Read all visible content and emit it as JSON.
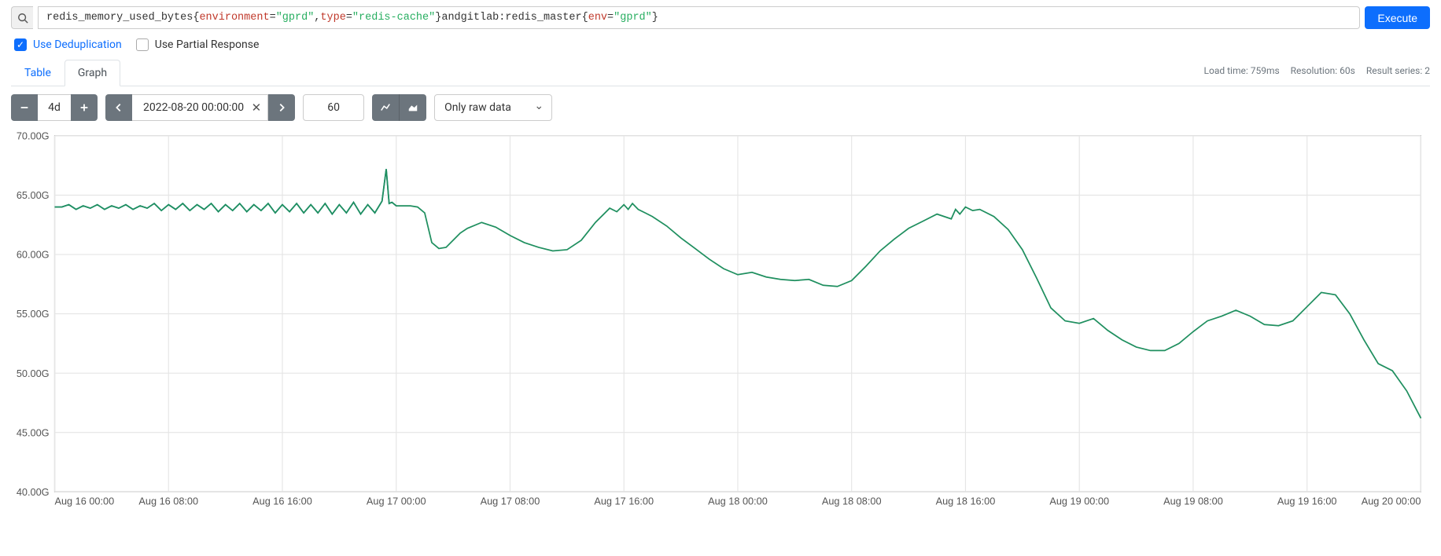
{
  "query": {
    "raw": "redis_memory_used_bytes{environment=\"gprd\", type=\"redis-cache\"} and gitlab:redis_master{env=\"gprd\"}",
    "tokens": [
      {
        "t": "metric",
        "v": "redis_memory_used_bytes"
      },
      {
        "t": "op",
        "v": "{"
      },
      {
        "t": "label",
        "v": "environment"
      },
      {
        "t": "op",
        "v": "="
      },
      {
        "t": "val",
        "v": "\"gprd\""
      },
      {
        "t": "op",
        "v": ", "
      },
      {
        "t": "label",
        "v": "type"
      },
      {
        "t": "op",
        "v": "="
      },
      {
        "t": "val",
        "v": "\"redis-cache\""
      },
      {
        "t": "op",
        "v": "} "
      },
      {
        "t": "metric",
        "v": "and"
      },
      {
        "t": "metric",
        "v": " gitlab:redis_master"
      },
      {
        "t": "op",
        "v": "{"
      },
      {
        "t": "label",
        "v": "env"
      },
      {
        "t": "op",
        "v": "="
      },
      {
        "t": "val",
        "v": "\"gprd\""
      },
      {
        "t": "op",
        "v": "}"
      }
    ]
  },
  "execute_label": "Execute",
  "options": {
    "dedup_label": "Use Deduplication",
    "dedup_checked": true,
    "partial_label": "Use Partial Response",
    "partial_checked": false
  },
  "tabs": {
    "table": "Table",
    "graph": "Graph",
    "active": "graph"
  },
  "status": {
    "load_time": "Load time: 759ms",
    "resolution": "Resolution: 60s",
    "series_count": "Result series: 2"
  },
  "controls": {
    "range": "4d",
    "end_time": "2022-08-20 00:00:00",
    "step": "60",
    "raw_label": "Only raw data"
  },
  "chart_data": {
    "type": "line",
    "xlabel": "",
    "ylabel": "",
    "ylim": [
      40,
      70
    ],
    "y_ticks": [
      "40.00G",
      "45.00G",
      "50.00G",
      "55.00G",
      "60.00G",
      "65.00G",
      "70.00G"
    ],
    "x_ticks": [
      "Aug 16 00:00",
      "Aug 16 08:00",
      "Aug 16 16:00",
      "Aug 17 00:00",
      "Aug 17 08:00",
      "Aug 17 16:00",
      "Aug 18 00:00",
      "Aug 18 08:00",
      "Aug 18 16:00",
      "Aug 19 00:00",
      "Aug 19 08:00",
      "Aug 19 16:00",
      "Aug 20 00:00"
    ],
    "xlim_hours": [
      0,
      96
    ],
    "series": [
      {
        "name": "series-1-teal",
        "color": "#2d8fa8",
        "x_hours": [
          0,
          0.5,
          1,
          1.5,
          2,
          2.5,
          3,
          3.5,
          4,
          4.5,
          5,
          5.5,
          6,
          6.5,
          7,
          7.5,
          8,
          8.5,
          9,
          9.5,
          10,
          10.5,
          11,
          11.5,
          12,
          12.5,
          13,
          13.5,
          14,
          14.5,
          15,
          15.5,
          16,
          16.5,
          17,
          17.5,
          18,
          18.5,
          19,
          19.5,
          20,
          20.5,
          21,
          21.5,
          22,
          22.5,
          23,
          23.3,
          23.5,
          23.7,
          24
        ],
        "values_g": [
          64.0,
          64.0,
          64.2,
          63.8,
          64.1,
          63.9,
          64.2,
          63.8,
          64.1,
          63.9,
          64.2,
          63.8,
          64.1,
          63.9,
          64.3,
          63.7,
          64.2,
          63.8,
          64.3,
          63.7,
          64.2,
          63.8,
          64.3,
          63.6,
          64.2,
          63.7,
          64.3,
          63.6,
          64.2,
          63.7,
          64.3,
          63.5,
          64.2,
          63.6,
          64.3,
          63.5,
          64.2,
          63.5,
          64.3,
          63.4,
          64.2,
          63.5,
          64.4,
          63.4,
          64.2,
          63.5,
          64.5,
          67.2,
          64.3,
          64.4,
          64.1
        ]
      },
      {
        "name": "series-2-green",
        "color": "#1f8f5f",
        "x_hours": [
          0,
          0.5,
          1,
          1.5,
          2,
          2.5,
          3,
          3.5,
          4,
          4.5,
          5,
          5.5,
          6,
          6.5,
          7,
          7.5,
          8,
          8.5,
          9,
          9.5,
          10,
          10.5,
          11,
          11.5,
          12,
          12.5,
          13,
          13.5,
          14,
          14.5,
          15,
          15.5,
          16,
          16.5,
          17,
          17.5,
          18,
          18.5,
          19,
          19.5,
          20,
          20.5,
          21,
          21.5,
          22,
          22.5,
          23,
          23.3,
          23.5,
          23.7,
          24,
          24.5,
          25,
          25.5,
          26,
          26.5,
          27,
          27.5,
          28,
          28.5,
          29,
          30,
          31,
          32,
          33,
          34,
          35,
          36,
          37,
          38,
          39,
          39.5,
          40,
          40.3,
          40.6,
          41,
          41.5,
          42,
          43,
          44,
          45,
          46,
          47,
          48,
          49,
          50,
          51,
          52,
          53,
          54,
          55,
          56,
          57,
          58,
          59,
          60,
          61,
          62,
          63,
          63.3,
          63.6,
          64,
          64.5,
          65,
          66,
          67,
          68,
          69,
          70,
          71,
          72,
          73,
          74,
          75,
          76,
          77,
          78,
          79,
          80,
          81,
          82,
          83,
          84,
          85,
          86,
          87,
          88,
          89,
          90,
          91,
          92,
          93,
          94,
          95,
          96
        ],
        "values_g": [
          64.0,
          64.0,
          64.2,
          63.8,
          64.1,
          63.9,
          64.2,
          63.8,
          64.1,
          63.9,
          64.2,
          63.8,
          64.1,
          63.9,
          64.3,
          63.7,
          64.2,
          63.8,
          64.3,
          63.7,
          64.2,
          63.8,
          64.3,
          63.6,
          64.2,
          63.7,
          64.3,
          63.6,
          64.2,
          63.7,
          64.3,
          63.5,
          64.2,
          63.6,
          64.3,
          63.5,
          64.2,
          63.5,
          64.3,
          63.4,
          64.2,
          63.5,
          64.4,
          63.4,
          64.2,
          63.5,
          64.5,
          67.2,
          64.3,
          64.4,
          64.1,
          64.1,
          64.1,
          64.0,
          63.5,
          61.0,
          60.5,
          60.6,
          61.2,
          61.8,
          62.2,
          62.7,
          62.3,
          61.6,
          61.0,
          60.6,
          60.3,
          60.4,
          61.2,
          62.7,
          63.9,
          63.6,
          64.2,
          63.8,
          64.3,
          63.8,
          63.5,
          63.2,
          62.4,
          61.4,
          60.5,
          59.6,
          58.8,
          58.3,
          58.5,
          58.1,
          57.9,
          57.8,
          57.9,
          57.4,
          57.3,
          57.8,
          59.0,
          60.3,
          61.3,
          62.2,
          62.8,
          63.4,
          63.0,
          63.8,
          63.4,
          64.0,
          63.7,
          63.8,
          63.2,
          62.1,
          60.4,
          58.0,
          55.5,
          54.4,
          54.2,
          54.6,
          53.6,
          52.8,
          52.2,
          51.9,
          51.9,
          52.5,
          53.5,
          54.4,
          54.8,
          55.3,
          54.8,
          54.1,
          54.0,
          54.4,
          55.6,
          56.8,
          56.6,
          55.0,
          52.8,
          50.8,
          50.2,
          48.5,
          46.2,
          44.5
        ]
      }
    ]
  }
}
